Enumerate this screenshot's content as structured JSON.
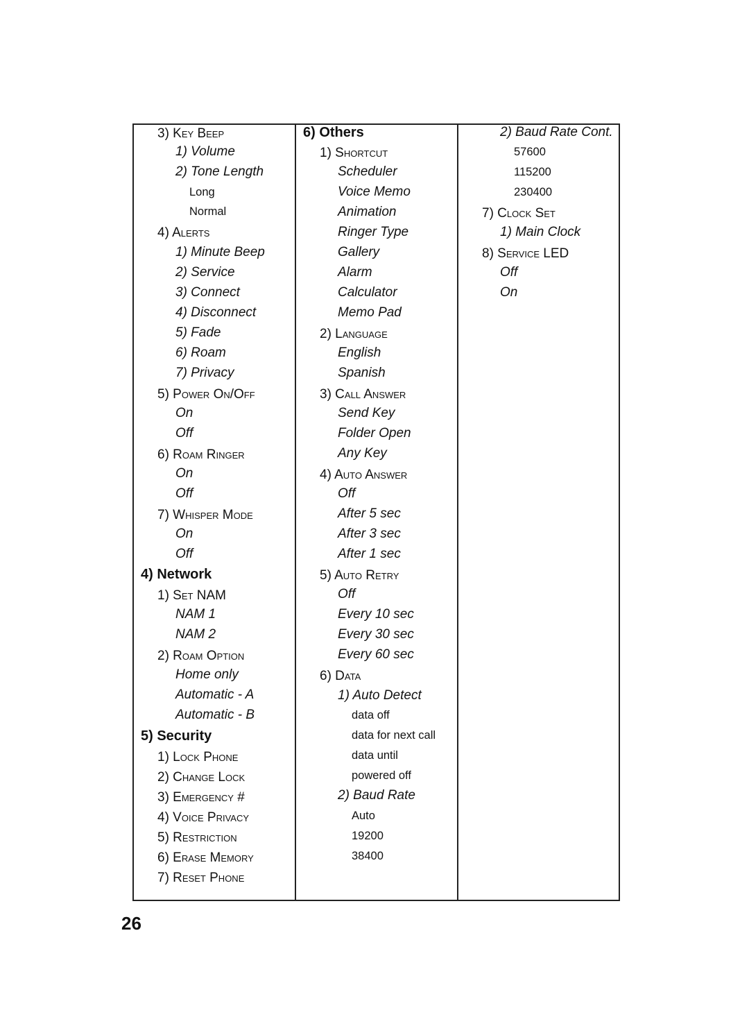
{
  "page_number": "26",
  "columns": [
    {
      "lines": [
        {
          "text": "3) Key Beep",
          "style": "sc",
          "indent": 1
        },
        {
          "text": "1) Volume",
          "style": "it",
          "indent": 2
        },
        {
          "text": "2) Tone Length",
          "style": "it",
          "indent": 2
        },
        {
          "text": "Long",
          "style": "pl",
          "indent": 3
        },
        {
          "text": "Normal",
          "style": "pl",
          "indent": 3
        },
        {
          "text": "4) Alerts",
          "style": "sc",
          "indent": 1
        },
        {
          "text": "1) Minute Beep",
          "style": "it",
          "indent": 2
        },
        {
          "text": "2) Service",
          "style": "it",
          "indent": 2
        },
        {
          "text": "3) Connect",
          "style": "it",
          "indent": 2
        },
        {
          "text": "4) Disconnect",
          "style": "it",
          "indent": 2
        },
        {
          "text": "5) Fade",
          "style": "it",
          "indent": 2
        },
        {
          "text": "6) Roam",
          "style": "it",
          "indent": 2
        },
        {
          "text": "7) Privacy",
          "style": "it",
          "indent": 2
        },
        {
          "text": "5) Power On/Off",
          "style": "sc",
          "indent": 1
        },
        {
          "text": "On",
          "style": "it",
          "indent": 2
        },
        {
          "text": "Off",
          "style": "it",
          "indent": 2
        },
        {
          "text": "6) Roam Ringer",
          "style": "sc",
          "indent": 1
        },
        {
          "text": "On",
          "style": "it",
          "indent": 2
        },
        {
          "text": "Off",
          "style": "it",
          "indent": 2
        },
        {
          "text": "7) Whisper Mode",
          "style": "sc",
          "indent": 1
        },
        {
          "text": "On",
          "style": "it",
          "indent": 2
        },
        {
          "text": "Off",
          "style": "it",
          "indent": 2
        },
        {
          "text": "4) Network",
          "style": "bold",
          "indent": 0
        },
        {
          "text": "1) Set NAM",
          "style": "sc",
          "indent": 1
        },
        {
          "text": "NAM 1",
          "style": "it",
          "indent": 2
        },
        {
          "text": "NAM 2",
          "style": "it",
          "indent": 2
        },
        {
          "text": "2) Roam Option",
          "style": "sc",
          "indent": 1
        },
        {
          "text": "Home only",
          "style": "it",
          "indent": 2
        },
        {
          "text": "Automatic - A",
          "style": "it",
          "indent": 2
        },
        {
          "text": "Automatic - B",
          "style": "it",
          "indent": 2
        },
        {
          "text": "5) Security",
          "style": "bold",
          "indent": 0
        },
        {
          "text": "1) Lock Phone",
          "style": "sc",
          "indent": 1
        },
        {
          "text": "2) Change Lock",
          "style": "sc",
          "indent": 1
        },
        {
          "text": "3) Emergency #",
          "style": "sc",
          "indent": 1
        },
        {
          "text": "4) Voice Privacy",
          "style": "sc",
          "indent": 1
        },
        {
          "text": "5) Restriction",
          "style": "sc",
          "indent": 1
        },
        {
          "text": "6) Erase Memory",
          "style": "sc",
          "indent": 1
        },
        {
          "text": "7) Reset Phone",
          "style": "sc",
          "indent": 1
        }
      ]
    },
    {
      "lines": [
        {
          "text": "6) Others",
          "style": "bold",
          "indent": 0
        },
        {
          "text": "1) Shortcut",
          "style": "sc",
          "indent": 1
        },
        {
          "text": "Scheduler",
          "style": "it",
          "indent": 2
        },
        {
          "text": "Voice Memo",
          "style": "it",
          "indent": 2
        },
        {
          "text": "Animation",
          "style": "it",
          "indent": 2
        },
        {
          "text": "Ringer Type",
          "style": "it",
          "indent": 2
        },
        {
          "text": "Gallery",
          "style": "it",
          "indent": 2
        },
        {
          "text": "Alarm",
          "style": "it",
          "indent": 2
        },
        {
          "text": "Calculator",
          "style": "it",
          "indent": 2
        },
        {
          "text": "Memo Pad",
          "style": "it",
          "indent": 2
        },
        {
          "text": "2) Language",
          "style": "sc",
          "indent": 1
        },
        {
          "text": "English",
          "style": "it",
          "indent": 2
        },
        {
          "text": "Spanish",
          "style": "it",
          "indent": 2
        },
        {
          "text": "3) Call Answer",
          "style": "sc",
          "indent": 1
        },
        {
          "text": "Send Key",
          "style": "it",
          "indent": 2
        },
        {
          "text": "Folder Open",
          "style": "it",
          "indent": 2
        },
        {
          "text": "Any Key",
          "style": "it",
          "indent": 2
        },
        {
          "text": "4) Auto Answer",
          "style": "sc",
          "indent": 1
        },
        {
          "text": "Off",
          "style": "it",
          "indent": 2
        },
        {
          "text": "After 5 sec",
          "style": "it",
          "indent": 2
        },
        {
          "text": "After 3 sec",
          "style": "it",
          "indent": 2
        },
        {
          "text": "After 1 sec",
          "style": "it",
          "indent": 2
        },
        {
          "text": "5) Auto Retry",
          "style": "sc",
          "indent": 1
        },
        {
          "text": "Off",
          "style": "it",
          "indent": 2
        },
        {
          "text": "Every 10 sec",
          "style": "it",
          "indent": 2
        },
        {
          "text": "Every 30 sec",
          "style": "it",
          "indent": 2
        },
        {
          "text": "Every 60 sec",
          "style": "it",
          "indent": 2
        },
        {
          "text": "6) Data",
          "style": "sc",
          "indent": 1
        },
        {
          "text": "1) Auto Detect",
          "style": "it",
          "indent": 2
        },
        {
          "text": "data off",
          "style": "pl",
          "indent": 3
        },
        {
          "text": "data for next call",
          "style": "pl",
          "indent": 3
        },
        {
          "text": "data until",
          "style": "pl",
          "indent": 3
        },
        {
          "text": "powered off",
          "style": "pl",
          "indent": 3
        },
        {
          "text": "2) Baud Rate",
          "style": "it",
          "indent": 2
        },
        {
          "text": "Auto",
          "style": "pl",
          "indent": 3
        },
        {
          "text": "19200",
          "style": "pl",
          "indent": 3
        },
        {
          "text": "38400",
          "style": "pl",
          "indent": 3
        }
      ]
    },
    {
      "lines": [
        {
          "text": "2) Baud Rate Cont.",
          "style": "it",
          "indent": 2
        },
        {
          "text": "57600",
          "style": "pl",
          "indent": 3
        },
        {
          "text": "115200",
          "style": "pl",
          "indent": 3
        },
        {
          "text": "230400",
          "style": "pl",
          "indent": 3
        },
        {
          "text": "7) Clock Set",
          "style": "sc",
          "indent": 1
        },
        {
          "text": "1) Main Clock",
          "style": "it",
          "indent": 2
        },
        {
          "text": "8) Service LED",
          "style": "sc",
          "indent": 1
        },
        {
          "text": "Off",
          "style": "it",
          "indent": 2
        },
        {
          "text": "On",
          "style": "it",
          "indent": 2
        }
      ]
    }
  ]
}
